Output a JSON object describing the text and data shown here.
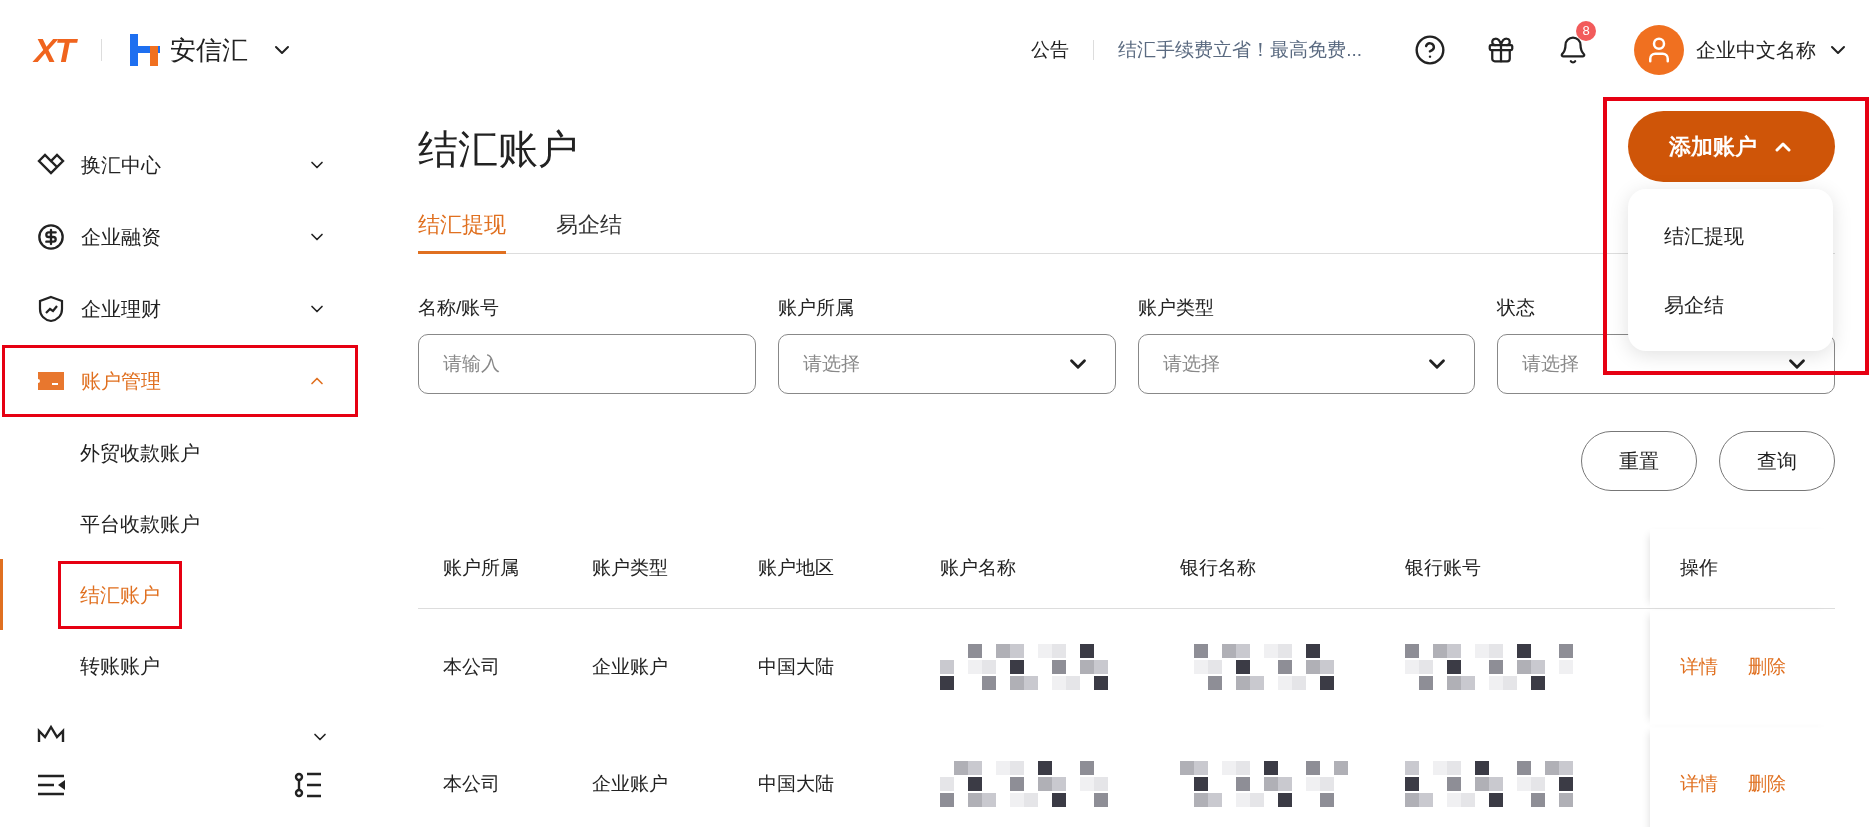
{
  "header": {
    "logo": "XT",
    "brand": "安信汇",
    "notice_label": "公告",
    "notice_text": "结汇手续费立省！最高免费...",
    "notification_count": "8",
    "user_name": "企业中文名称"
  },
  "sidebar": {
    "items": [
      {
        "label": "换汇中心",
        "expanded": false,
        "selected": false,
        "highlighted": false
      },
      {
        "label": "企业融资",
        "expanded": false,
        "selected": false,
        "highlighted": false
      },
      {
        "label": "企业理财",
        "expanded": false,
        "selected": false,
        "highlighted": false
      },
      {
        "label": "账户管理",
        "expanded": true,
        "selected": true,
        "highlighted": true,
        "children": [
          {
            "label": "外贸收款账户",
            "selected": false,
            "highlighted": false
          },
          {
            "label": "平台收款账户",
            "selected": false,
            "highlighted": false
          },
          {
            "label": "结汇账户",
            "selected": true,
            "highlighted": true
          },
          {
            "label": "转账账户",
            "selected": false,
            "highlighted": false
          }
        ]
      }
    ]
  },
  "page": {
    "title": "结汇账户",
    "add_account": {
      "label": "添加账户",
      "expanded": true,
      "highlighted": true,
      "menu": [
        "结汇提现",
        "易企结"
      ]
    },
    "tabs": [
      {
        "label": "结汇提现",
        "selected": true
      },
      {
        "label": "易企结",
        "selected": false
      }
    ],
    "filters": [
      {
        "label": "名称/账号",
        "placeholder": "请输入",
        "kind": "text"
      },
      {
        "label": "账户所属",
        "placeholder": "请选择",
        "kind": "select"
      },
      {
        "label": "账户类型",
        "placeholder": "请选择",
        "kind": "select"
      },
      {
        "label": "状态",
        "placeholder": "请选择",
        "kind": "select"
      }
    ],
    "buttons": [
      "重置",
      "查询"
    ],
    "table": {
      "columns": [
        "账户所属",
        "账户类型",
        "账户地区",
        "账户名称",
        "银行名称",
        "银行账号",
        "操作"
      ],
      "rows": [
        {
          "cells": [
            {
              "kind": "text",
              "text": "本公司"
            },
            {
              "kind": "text",
              "text": "企业账户"
            },
            {
              "kind": "text",
              "text": "中国大陆"
            },
            {
              "kind": "redacted"
            },
            {
              "kind": "redacted"
            },
            {
              "kind": "redacted"
            }
          ],
          "actions": [
            "详情",
            "删除"
          ]
        },
        {
          "cells": [
            {
              "kind": "text",
              "text": "本公司"
            },
            {
              "kind": "text",
              "text": "企业账户"
            },
            {
              "kind": "text",
              "text": "中国大陆"
            },
            {
              "kind": "redacted"
            },
            {
              "kind": "redacted"
            },
            {
              "kind": "redacted"
            }
          ],
          "actions": [
            "详情",
            "删除"
          ]
        }
      ]
    }
  }
}
